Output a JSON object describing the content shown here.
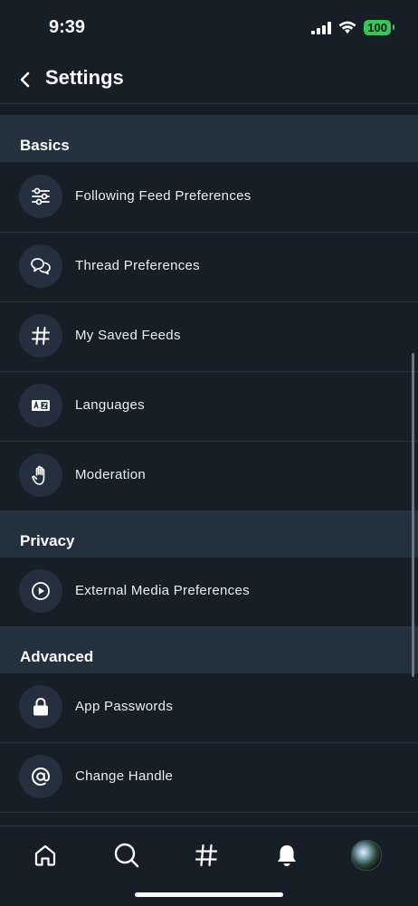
{
  "status_bar": {
    "time": "9:39",
    "battery": "100"
  },
  "header": {
    "title": "Settings"
  },
  "sections": {
    "basics": {
      "title": "Basics",
      "items": [
        {
          "label": "Following Feed Preferences",
          "icon": "sliders-icon"
        },
        {
          "label": "Thread Preferences",
          "icon": "chat-bubbles-icon"
        },
        {
          "label": "My Saved Feeds",
          "icon": "hashtag-icon"
        },
        {
          "label": "Languages",
          "icon": "language-icon"
        },
        {
          "label": "Moderation",
          "icon": "hand-icon"
        }
      ]
    },
    "privacy": {
      "title": "Privacy",
      "items": [
        {
          "label": "External Media Preferences",
          "icon": "play-circle-icon"
        }
      ]
    },
    "advanced": {
      "title": "Advanced",
      "items": [
        {
          "label": "App Passwords",
          "icon": "lock-icon"
        },
        {
          "label": "Change Handle",
          "icon": "at-sign-icon"
        }
      ]
    }
  },
  "tab_bar": [
    "home-icon",
    "search-icon",
    "feeds-hashtag-icon",
    "notifications-bell-icon",
    "profile-avatar"
  ],
  "colors": {
    "background": "#161e27",
    "section": "#24313f",
    "icon_bg": "#243040",
    "battery": "#34c759"
  }
}
